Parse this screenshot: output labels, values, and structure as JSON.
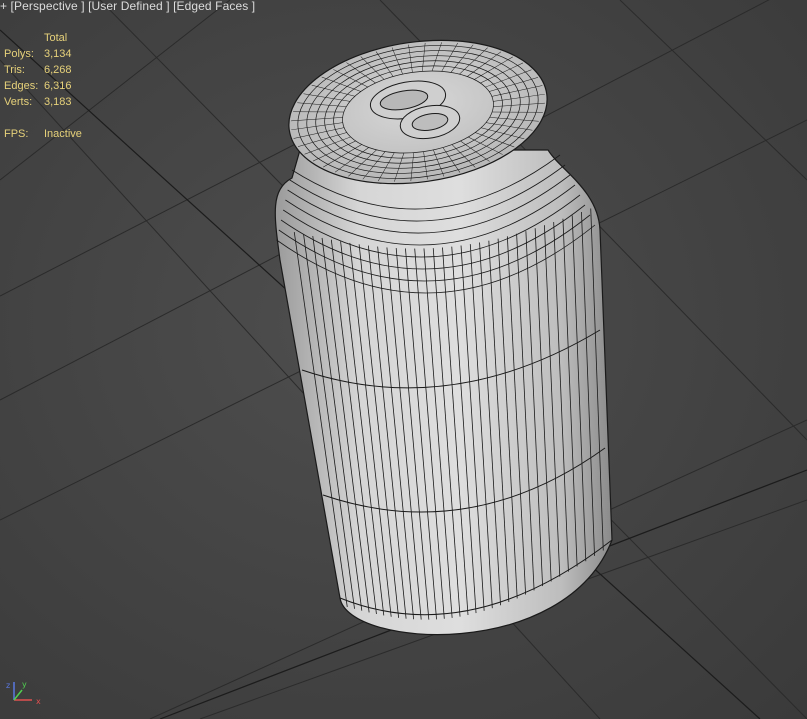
{
  "viewport": {
    "label_plus": "+",
    "label_view": "[Perspective ]",
    "label_shading": "[User Defined ]",
    "label_edges": "[Edged Faces ]"
  },
  "stats": {
    "header": "Total",
    "rows": [
      {
        "key": "Polys:",
        "value": "3,134"
      },
      {
        "key": "Tris:",
        "value": "6,268"
      },
      {
        "key": "Edges:",
        "value": "6,316"
      },
      {
        "key": "Verts:",
        "value": "3,183"
      }
    ],
    "fps_key": "FPS:",
    "fps_value": "Inactive"
  },
  "colors": {
    "stats_text": "#e6d17a",
    "label_text": "#dcdcdc",
    "background": "#444444",
    "grid_line": "#2a2a2a",
    "mesh_face": "#c8c8c8",
    "mesh_edge": "#1a1a1a"
  },
  "axis_tripod": {
    "icon": "xyz-gizmo-icon"
  }
}
